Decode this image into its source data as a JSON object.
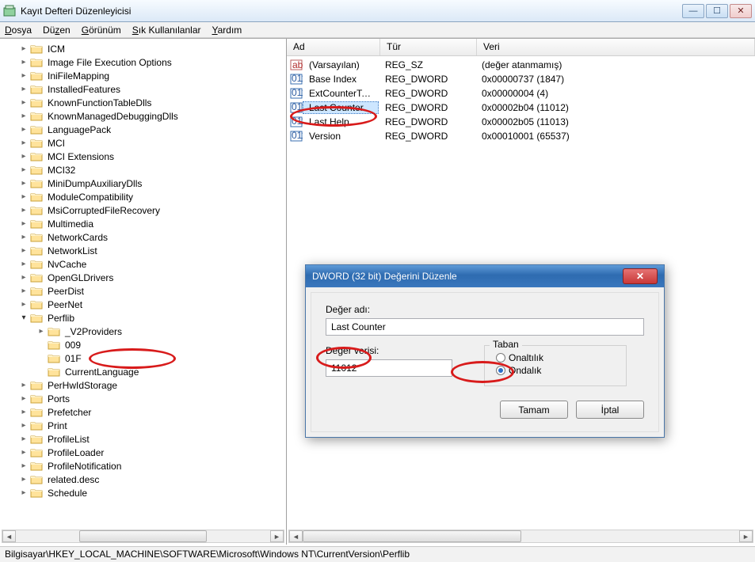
{
  "window": {
    "title": "Kayıt Defteri Düzenleyicisi"
  },
  "menu": {
    "file": "Dosya",
    "edit": "Düzen",
    "view": "Görünüm",
    "favorites": "Sık Kullanılanlar",
    "help": "Yardım"
  },
  "tree": {
    "items": [
      "ICM",
      "Image File Execution Options",
      "IniFileMapping",
      "InstalledFeatures",
      "KnownFunctionTableDlls",
      "KnownManagedDebuggingDlls",
      "LanguagePack",
      "MCI",
      "MCI Extensions",
      "MCI32",
      "MiniDumpAuxiliaryDlls",
      "ModuleCompatibility",
      "MsiCorruptedFileRecovery",
      "Multimedia",
      "NetworkCards",
      "NetworkList",
      "NvCache",
      "OpenGLDrivers",
      "PeerDist",
      "PeerNet",
      "Perflib",
      "PerHwIdStorage",
      "Ports",
      "Prefetcher",
      "Print",
      "ProfileList",
      "ProfileLoader",
      "ProfileNotification",
      "related.desc",
      "Schedule"
    ],
    "perflib_children": [
      "_V2Providers",
      "009",
      "01F",
      "CurrentLanguage"
    ]
  },
  "list": {
    "headers": {
      "name": "Ad",
      "type": "Tür",
      "data": "Veri"
    },
    "rows": [
      {
        "icon": "sz",
        "name": "(Varsayılan)",
        "type": "REG_SZ",
        "data": "(değer atanmamış)"
      },
      {
        "icon": "dw",
        "name": "Base Index",
        "type": "REG_DWORD",
        "data": "0x00000737 (1847)"
      },
      {
        "icon": "dw",
        "name": "ExtCounterTestL...",
        "type": "REG_DWORD",
        "data": "0x00000004 (4)"
      },
      {
        "icon": "dw",
        "name": "Last Counter",
        "type": "REG_DWORD",
        "data": "0x00002b04 (11012)",
        "selected": true
      },
      {
        "icon": "dw",
        "name": "Last Help",
        "type": "REG_DWORD",
        "data": "0x00002b05 (11013)"
      },
      {
        "icon": "dw",
        "name": "Version",
        "type": "REG_DWORD",
        "data": "0x00010001 (65537)"
      }
    ]
  },
  "statusbar": "Bilgisayar\\HKEY_LOCAL_MACHINE\\SOFTWARE\\Microsoft\\Windows NT\\CurrentVersion\\Perflib",
  "dialog": {
    "title": "DWORD (32 bit) Değerini Düzenle",
    "name_label": "Değer adı:",
    "name_value": "Last Counter",
    "data_label": "Değer verisi:",
    "data_value": "11012",
    "base_label": "Taban",
    "radio_hex": "Onaltılık",
    "radio_dec": "Ondalık",
    "ok": "Tamam",
    "cancel": "İptal"
  }
}
